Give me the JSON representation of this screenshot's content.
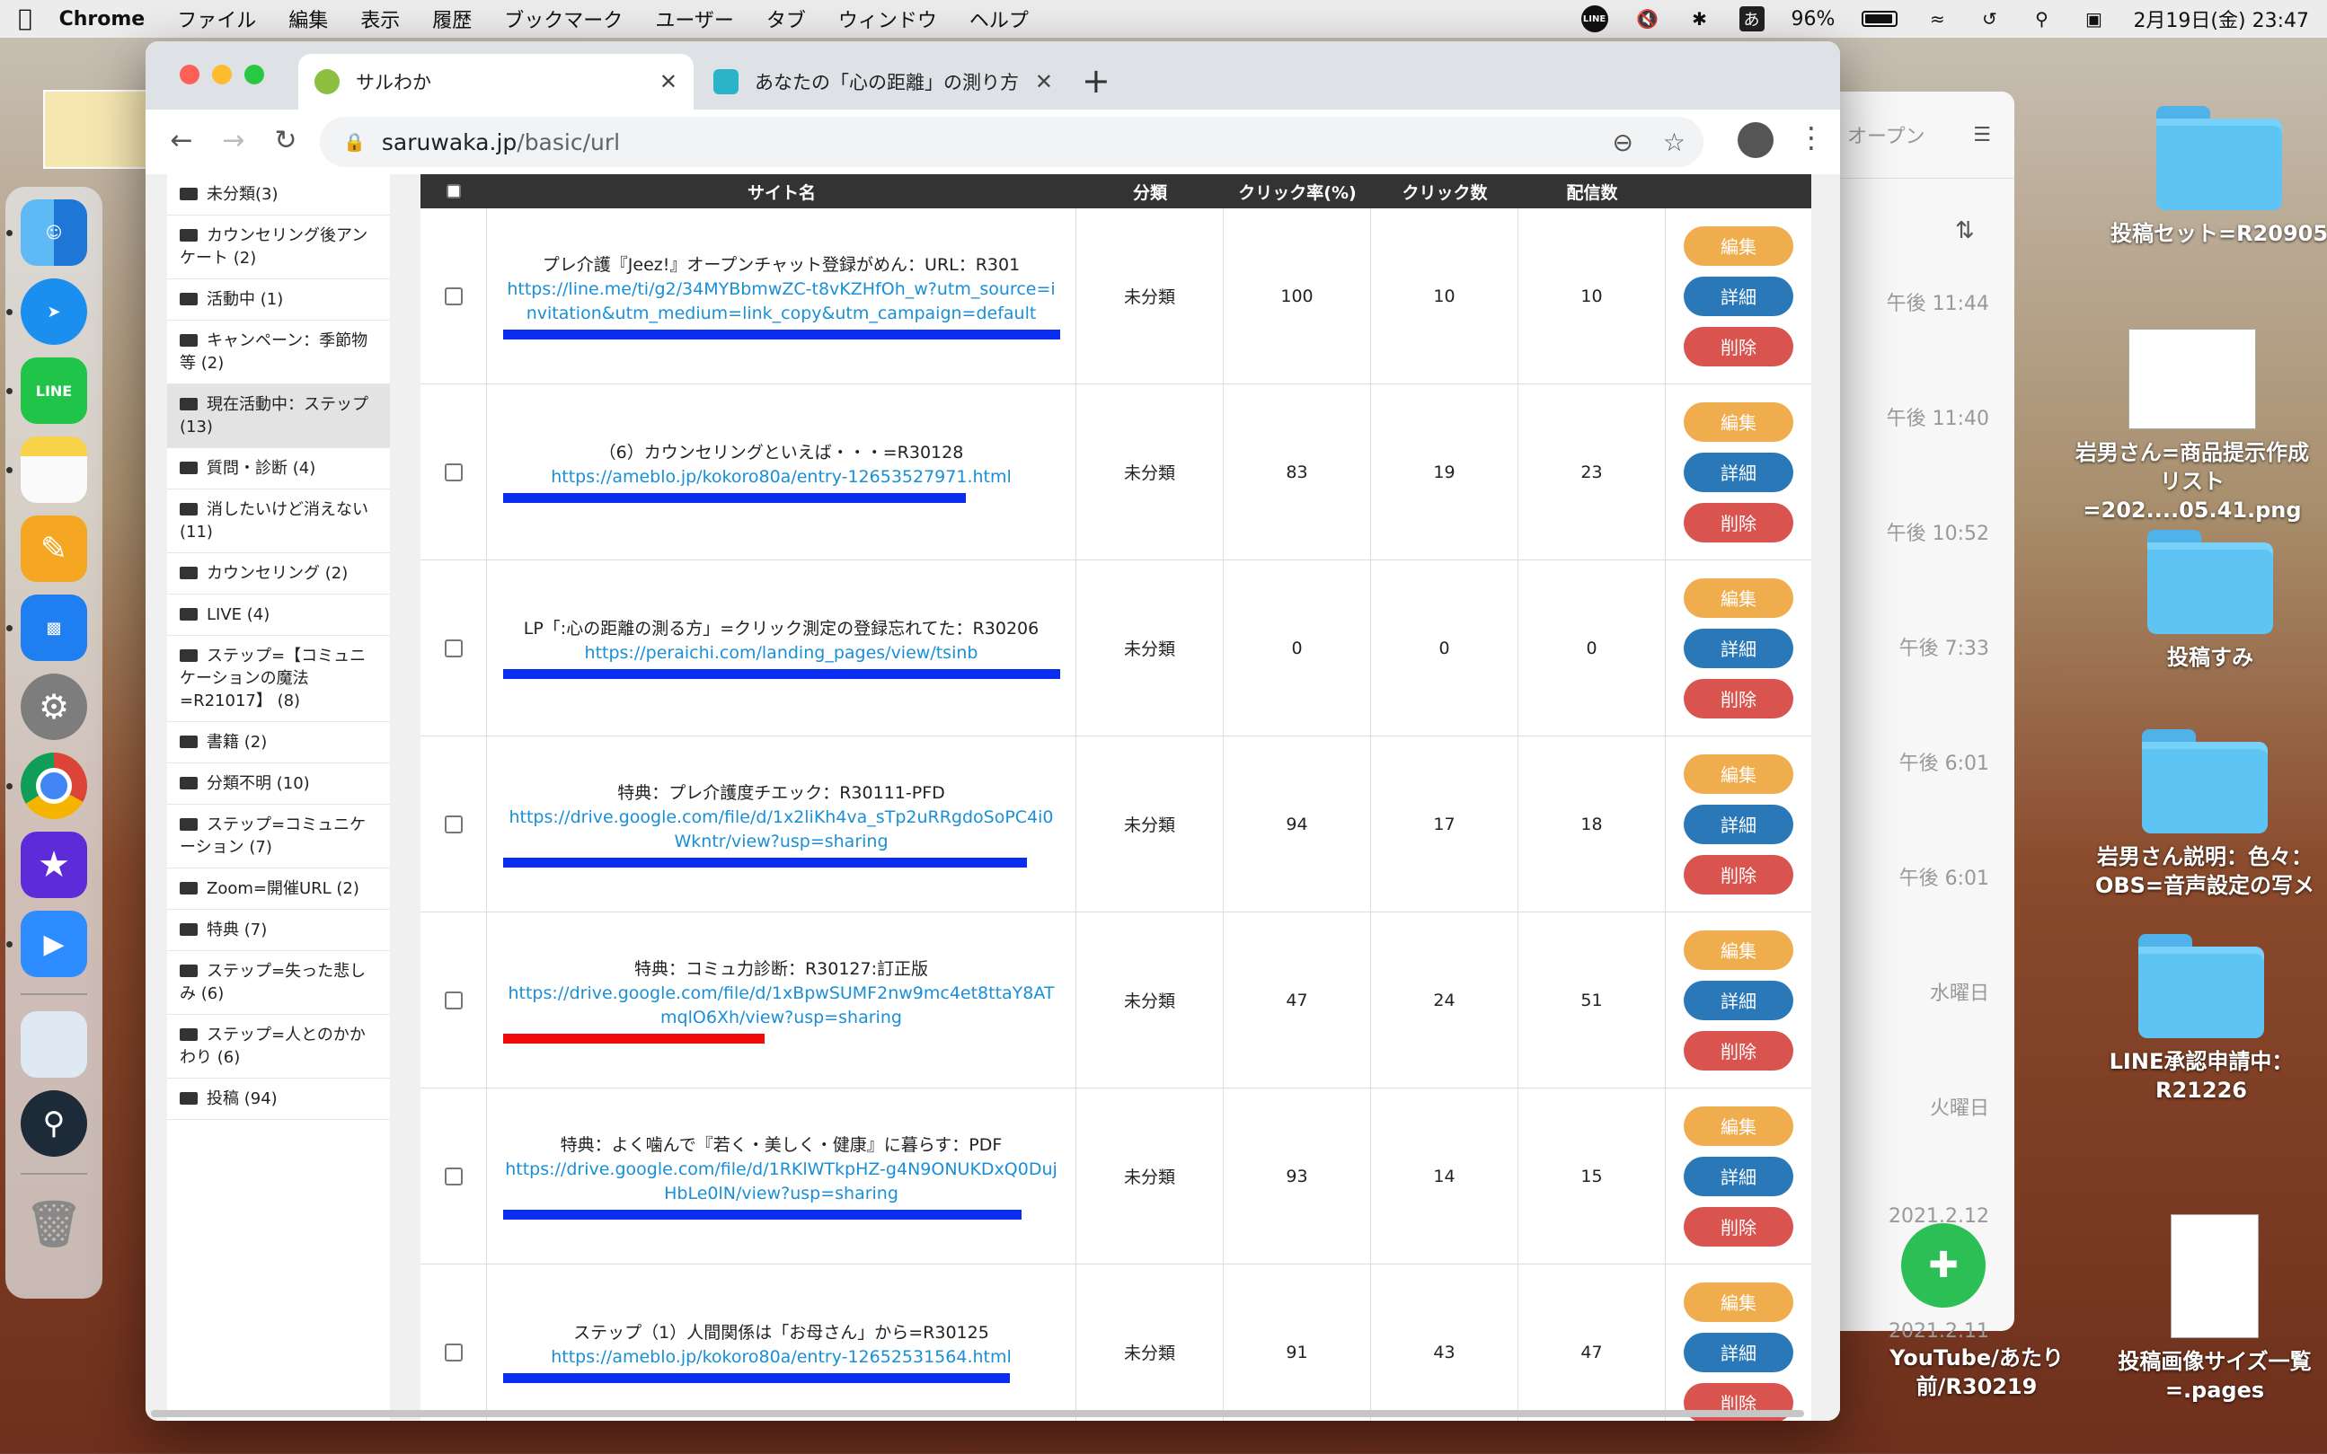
{
  "menubar": {
    "apple": "",
    "app": "Chrome",
    "items": [
      "ファイル",
      "編集",
      "表示",
      "履歴",
      "ブックマーク",
      "ユーザー",
      "タブ",
      "ウィンドウ",
      "ヘルプ"
    ],
    "battery": "96%",
    "datetime": "2月19日(金)  23:47",
    "line_badge": "LINE",
    "ime": "あ"
  },
  "browser": {
    "tabs": [
      {
        "title": "サルわか",
        "active": true
      },
      {
        "title": "あなたの「心の距離」の測り方",
        "active": false
      }
    ],
    "url_host": "saruwaka.jp",
    "url_path": "/basic/url"
  },
  "sidebar": {
    "categories": [
      {
        "label": "未分類(3)"
      },
      {
        "label": "カウンセリング後アンケート (2)"
      },
      {
        "label": "活動中 (1)"
      },
      {
        "label": "キャンペーン：季節物等 (2)"
      },
      {
        "label": "現在活動中：ステップ (13)",
        "active": true
      },
      {
        "label": "質問・診断 (4)"
      },
      {
        "label": "消したいけど消えない (11)"
      },
      {
        "label": "カウンセリング (2)"
      },
      {
        "label": "LIVE (4)"
      },
      {
        "label": "ステップ=【コミュニケーションの魔法=R21017】 (8)"
      },
      {
        "label": "書籍 (2)"
      },
      {
        "label": "分類不明 (10)"
      },
      {
        "label": "ステップ=コミュニケーション (7)"
      },
      {
        "label": "Zoom=開催URL (2)"
      },
      {
        "label": "特典 (7)"
      },
      {
        "label": "ステップ=失った悲しみ (6)"
      },
      {
        "label": "ステップ=人とのかかわり (6)"
      },
      {
        "label": "投稿 (94)"
      }
    ]
  },
  "table": {
    "headers": {
      "site": "サイト名",
      "category": "分類",
      "rate": "クリック率(%)",
      "clicks": "クリック数",
      "sent": "配信数"
    },
    "buttons": {
      "edit": "編集",
      "detail": "詳細",
      "delete": "削除"
    },
    "rows": [
      {
        "title": "プレ介護『Jeez!』オープンチャット登録がめん：URL：R301",
        "url": "https://line.me/ti/g2/34MYBbmwZC-t8vKZHfOh_w?utm_source=invitation&utm_medium=link_copy&utm_campaign=default",
        "category": "未分類",
        "rate": "100",
        "clicks": "10",
        "sent": "10",
        "mark_color": "#0a2df0",
        "mark_fraction": 1.0
      },
      {
        "title": "（6）カウンセリングといえば・・・=R30128",
        "url": "https://ameblo.jp/kokoro80a/entry-12653527971.html",
        "category": "未分類",
        "rate": "83",
        "clicks": "19",
        "sent": "23",
        "mark_color": "#0a2df0",
        "mark_fraction": 0.83
      },
      {
        "title": "LP「:心の距離の測る方」=クリック測定の登録忘れてた：R30206",
        "url": "https://peraichi.com/landing_pages/view/tsinb",
        "category": "未分類",
        "rate": "0",
        "clicks": "0",
        "sent": "0",
        "mark_color": "#0a2df0",
        "mark_fraction": 1.0
      },
      {
        "title": "特典：プレ介護度チエック：R30111-PFD",
        "url": "https://drive.google.com/file/d/1x2liKh4va_sTp2uRRgdoSoPC4i0Wkntr/view?usp=sharing",
        "category": "未分類",
        "rate": "94",
        "clicks": "17",
        "sent": "18",
        "mark_color": "#0a2df0",
        "mark_fraction": 0.94
      },
      {
        "title": "特典：コミュ力診断：R30127:訂正版",
        "url": "https://drive.google.com/file/d/1xBpwSUMF2nw9mc4et8ttaY8ATmqlO6Xh/view?usp=sharing",
        "category": "未分類",
        "rate": "47",
        "clicks": "24",
        "sent": "51",
        "mark_color": "#f00a0a",
        "mark_fraction": 0.47
      },
      {
        "title": "特典：よく噛んで『若く・美しく・健康』に暮らす：PDF",
        "url": "https://drive.google.com/file/d/1RKlWTkpHZ-g4N9ONUKDxQ0DujHbLe0lN/view?usp=sharing",
        "category": "未分類",
        "rate": "93",
        "clicks": "14",
        "sent": "15",
        "mark_color": "#0a2df0",
        "mark_fraction": 0.93
      },
      {
        "title": "ステップ（1）人間関係は「お母さん」から=R30125",
        "url": "https://ameblo.jp/kokoro80a/entry-12652531564.html",
        "category": "未分類",
        "rate": "91",
        "clicks": "43",
        "sent": "47",
        "mark_color": "#0a2df0",
        "mark_fraction": 0.91
      }
    ]
  },
  "background_window": {
    "header": "オープン",
    "times": [
      "午後 11:44",
      "午後 11:40",
      "午後 10:52",
      "午後 7:33",
      "午後 6:01",
      "午後 6:01",
      "水曜日",
      "火曜日",
      "2021.2.12",
      "2021.2.11"
    ]
  },
  "desktop": {
    "items": [
      {
        "label": "投稿セット=R20905"
      },
      {
        "label": "岩男さん=商品提示作成リスト=202....05.41.png"
      },
      {
        "label": "投稿すみ"
      },
      {
        "label": "岩男さん説明：色々：OBS=音声設定の写メ"
      },
      {
        "label": "LINE承認申請中：R21226"
      },
      {
        "label": "YouTube/あたり前/R30219"
      },
      {
        "label": "投稿画像サイズ一覧=.pages"
      }
    ]
  }
}
